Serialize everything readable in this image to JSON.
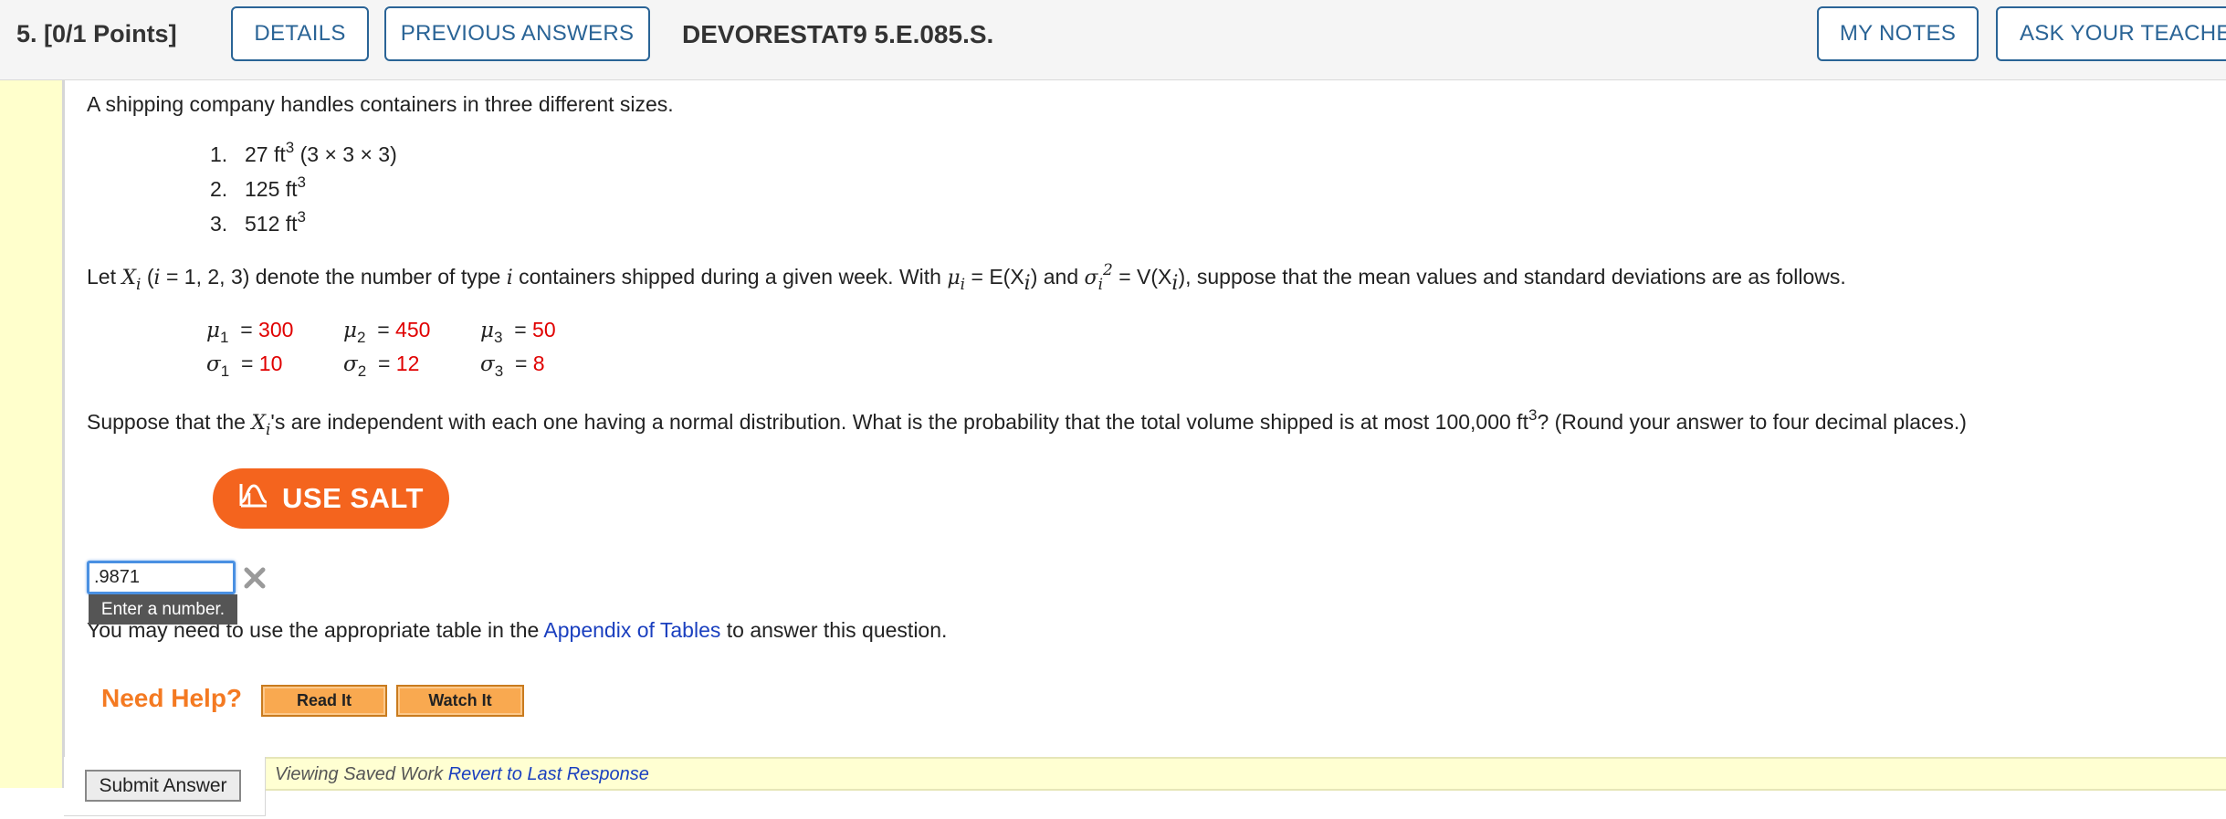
{
  "header": {
    "question_number": "5.",
    "points": "[0/1 Points]",
    "details_label": "DETAILS",
    "previous_answers_label": "PREVIOUS ANSWERS",
    "question_code": "DEVORESTAT9 5.E.085.S.",
    "my_notes_label": "MY NOTES",
    "ask_teacher_label": "ASK YOUR TEACHER"
  },
  "problem": {
    "intro": "A shipping company handles containers in three different sizes.",
    "sizes": [
      {
        "num": "1.",
        "value": "27 ft",
        "exp": "3",
        "extra": " (3 × 3 × 3)"
      },
      {
        "num": "2.",
        "value": "125 ft",
        "exp": "3",
        "extra": ""
      },
      {
        "num": "3.",
        "value": "512 ft",
        "exp": "3",
        "extra": ""
      }
    ],
    "let_text": {
      "p1": "Let ",
      "p2": " (",
      "p3": " = 1, 2, 3) denote the number of type ",
      "p4": " containers shipped during a given week. With ",
      "p5": " = E(X",
      "p6": ") and ",
      "p7": " = V(X",
      "p8": "), suppose that the mean values and standard deviations are as follows."
    },
    "params": {
      "mu": [
        {
          "sub": "1",
          "value": "300"
        },
        {
          "sub": "2",
          "value": "450"
        },
        {
          "sub": "3",
          "value": "50"
        }
      ],
      "sigma": [
        {
          "sub": "1",
          "value": "10"
        },
        {
          "sub": "2",
          "value": "12"
        },
        {
          "sub": "3",
          "value": "8"
        }
      ]
    },
    "suppose_text": {
      "p1": "Suppose that the ",
      "p2": "'s are independent with each one having a normal distribution. What is the probability that the total volume shipped is at most 100,000 ft",
      "exp": "3",
      "p3": "? (Round your answer to four decimal places.)"
    }
  },
  "salt": {
    "label": "USE SALT"
  },
  "answer": {
    "value": ".9871",
    "tooltip": "Enter a number."
  },
  "appendix": {
    "before": "You may need to use the appropriate table in the ",
    "link": "Appendix of Tables",
    "after": " to answer this question."
  },
  "help": {
    "label": "Need Help?",
    "read_it": "Read It",
    "watch_it": "Watch It"
  },
  "footer": {
    "submit_label": "Submit Answer",
    "viewing_text": "Viewing Saved Work ",
    "revert_link": "Revert to Last Response"
  },
  "colors": {
    "accent": "#2a6496",
    "salt": "#f4641e",
    "need_help": "#f47a22",
    "param_values": "#e00000",
    "link": "#1a3fbf"
  }
}
